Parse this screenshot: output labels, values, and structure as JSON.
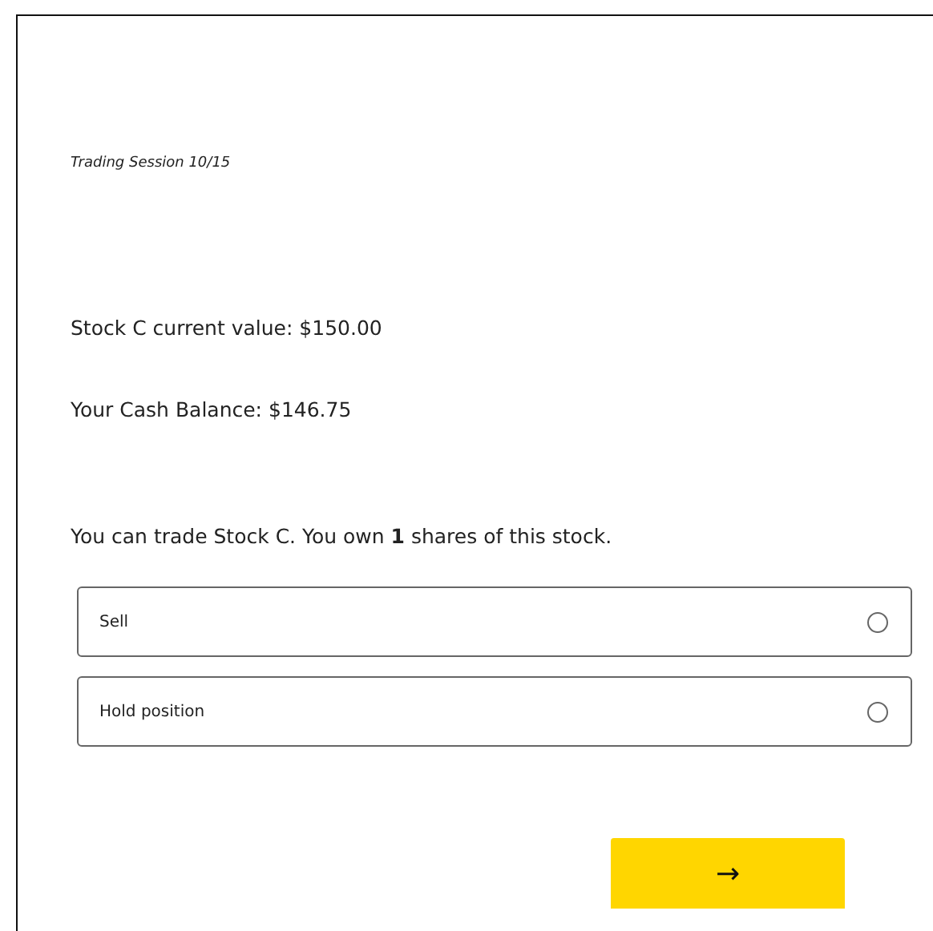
{
  "session_label": "Trading Session 10/15",
  "stock_value": "Stock C current value: $150.00",
  "cash_balance": "Your Cash Balance: $146.75",
  "prompt": "You can trade Stock C. You own **1** shares of this stock.",
  "options": [
    {
      "label": "Sell",
      "selected": false
    },
    {
      "label": "Hold position",
      "selected": false
    }
  ],
  "next_button": "→"
}
